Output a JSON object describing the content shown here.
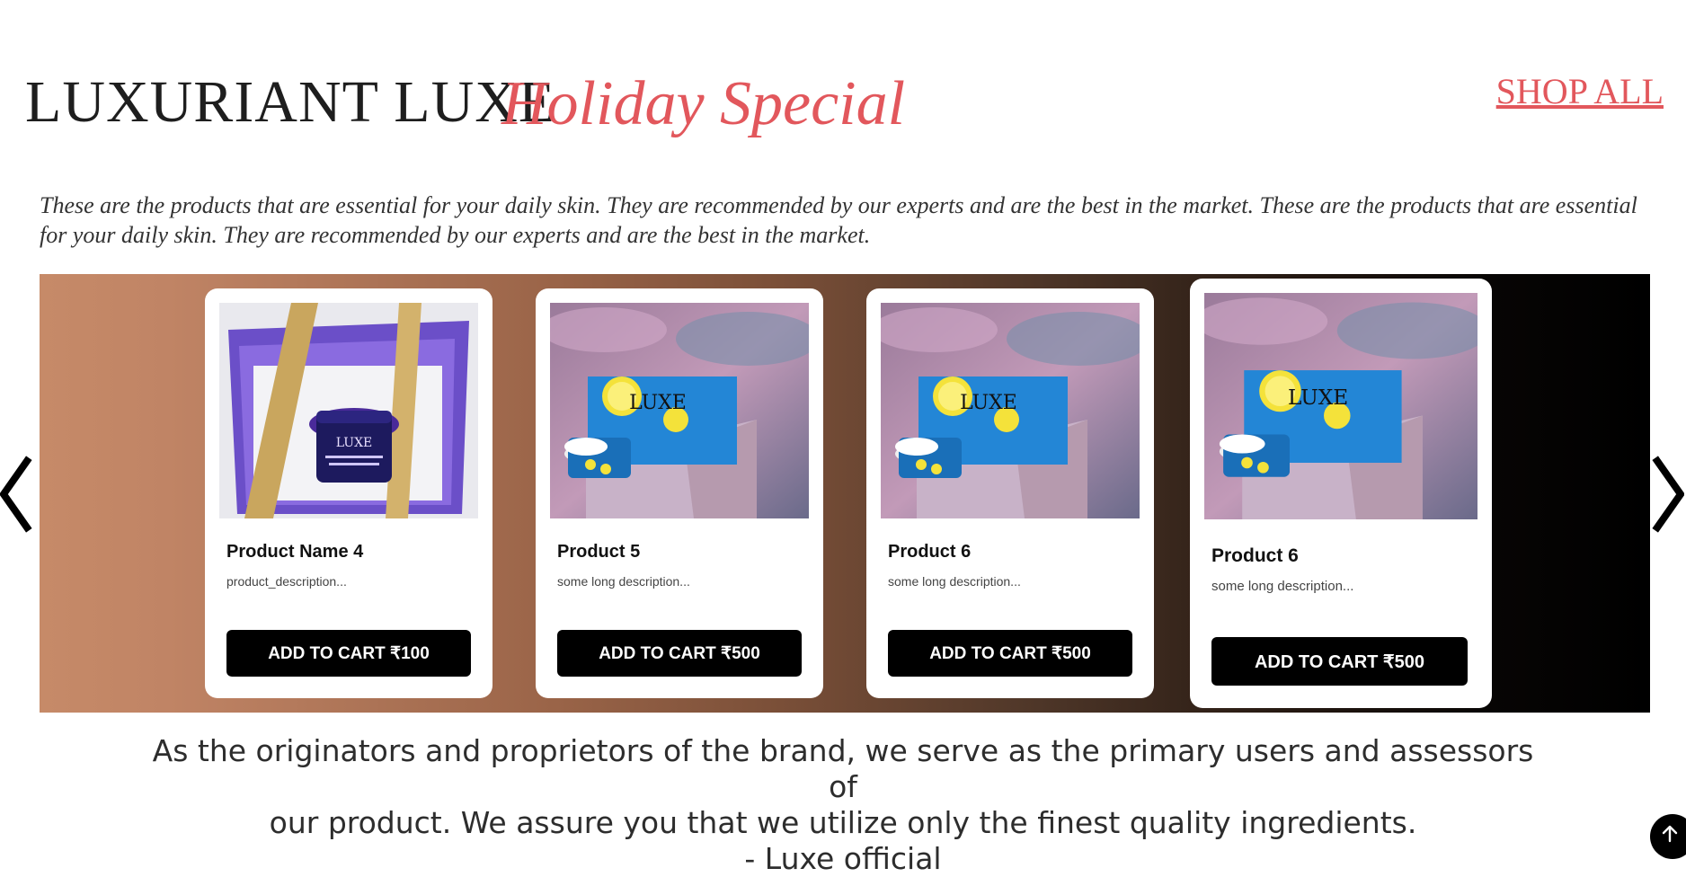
{
  "header": {
    "brand": "LUXURIANT LUXE",
    "subtitle": "Holiday Special",
    "shop_all": "SHOP ALL"
  },
  "intro": "These are the products that are essential for your daily skin. They are recommended by our experts and are the best in the market. These are the products that are essential for your daily skin. They are recommended by our experts and are the best in the market.",
  "carousel": {
    "prev_icon": "chevron-left-icon",
    "next_icon": "chevron-right-icon",
    "products": [
      {
        "title": "Product Name 4",
        "description": "product_description...",
        "button": "ADD TO CART ₹100",
        "image": "purple-gift-box-jar-image"
      },
      {
        "title": "Product 5",
        "description": "some long description...",
        "button": "ADD TO CART ₹500",
        "image": "blue-lemon-box-jar-image"
      },
      {
        "title": "Product 6",
        "description": "some long description...",
        "button": "ADD TO CART ₹500",
        "image": "blue-lemon-box-jar-image"
      },
      {
        "title": "Product 6",
        "description": "some long description...",
        "button": "ADD TO CART ₹500",
        "image": "blue-lemon-box-jar-image"
      }
    ]
  },
  "quote": {
    "line1": "As the originators and proprietors of the brand, we serve as the primary users and assessors of",
    "line2": "our product. We assure you that we utilize only the finest quality ingredients.",
    "signature": "- Luxe official"
  },
  "scroll_top_icon": "arrow-up-icon",
  "colors": {
    "accent": "#e2575c",
    "button": "#000000",
    "band_start": "#c68a68",
    "band_end": "#000000"
  }
}
